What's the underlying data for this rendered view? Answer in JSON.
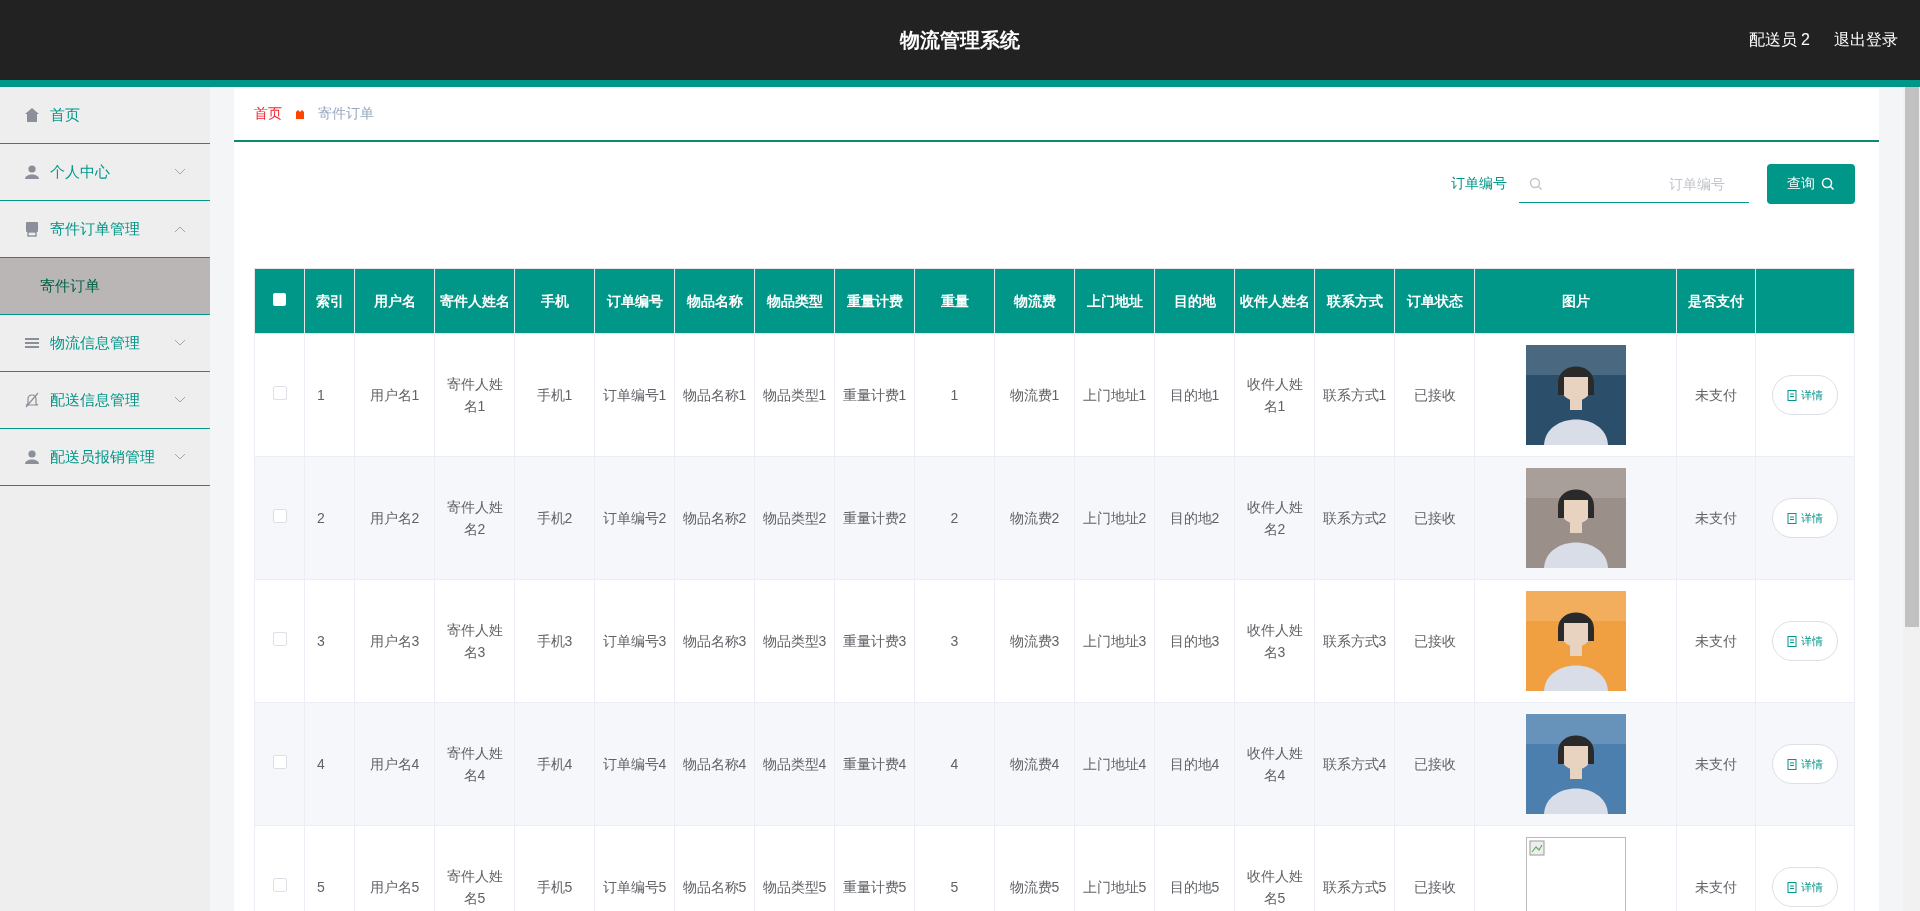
{
  "header": {
    "title": "物流管理系统",
    "user": "配送员 2",
    "logout": "退出登录"
  },
  "sidebar": {
    "items": [
      {
        "kind": "link",
        "label": "首页"
      },
      {
        "kind": "group",
        "label": "个人中心",
        "expanded": false
      },
      {
        "kind": "group",
        "label": "寄件订单管理",
        "expanded": true,
        "children": [
          {
            "label": "寄件订单",
            "selected": true
          }
        ]
      },
      {
        "kind": "group",
        "label": "物流信息管理",
        "expanded": false
      },
      {
        "kind": "group",
        "label": "配送信息管理",
        "expanded": false
      },
      {
        "kind": "group",
        "label": "配送员报销管理",
        "expanded": false
      }
    ]
  },
  "breadcrumb": {
    "home": "首页",
    "current": "寄件订单"
  },
  "search": {
    "label": "订单编号",
    "placeholder": "订单编号",
    "button": "查询"
  },
  "table": {
    "all_checked": false,
    "columns": [
      "索引",
      "用户名",
      "寄件人姓名",
      "手机",
      "订单编号",
      "物品名称",
      "物品类型",
      "重量计费",
      "重量",
      "物流费",
      "上门地址",
      "目的地",
      "收件人姓名",
      "联系方式",
      "订单状态",
      "图片",
      "是否支付"
    ],
    "rows": [
      {
        "selected": false,
        "cells": [
          "1",
          "用户名1",
          "寄件人姓名1",
          "手机1",
          "订单编号1",
          "物品名称1",
          "物品类型1",
          "重量计费1",
          "1",
          "物流费1",
          "上门地址1",
          "目的地1",
          "收件人姓名1",
          "联系方式1",
          "已接收"
        ],
        "paid": "未支付",
        "action": "详情"
      },
      {
        "selected": false,
        "cells": [
          "2",
          "用户名2",
          "寄件人姓名2",
          "手机2",
          "订单编号2",
          "物品名称2",
          "物品类型2",
          "重量计费2",
          "2",
          "物流费2",
          "上门地址2",
          "目的地2",
          "收件人姓名2",
          "联系方式2",
          "已接收"
        ],
        "paid": "未支付",
        "action": "详情"
      },
      {
        "selected": false,
        "cells": [
          "3",
          "用户名3",
          "寄件人姓名3",
          "手机3",
          "订单编号3",
          "物品名称3",
          "物品类型3",
          "重量计费3",
          "3",
          "物流费3",
          "上门地址3",
          "目的地3",
          "收件人姓名3",
          "联系方式3",
          "已接收"
        ],
        "paid": "未支付",
        "action": "详情"
      },
      {
        "selected": false,
        "cells": [
          "4",
          "用户名4",
          "寄件人姓名4",
          "手机4",
          "订单编号4",
          "物品名称4",
          "物品类型4",
          "重量计费4",
          "4",
          "物流费4",
          "上门地址4",
          "目的地4",
          "收件人姓名4",
          "联系方式4",
          "已接收"
        ],
        "paid": "未支付",
        "action": "详情"
      },
      {
        "selected": false,
        "cells": [
          "5",
          "用户名5",
          "寄件人姓名5",
          "手机5",
          "订单编号5",
          "物品名称5",
          "物品类型5",
          "重量计费5",
          "5",
          "物流费5",
          "上门地址5",
          "目的地5",
          "收件人姓名5",
          "联系方式5",
          "已接收"
        ],
        "picture": {
          "kind": "broken"
        },
        "paid": "未支付",
        "action": "详情"
      }
    ]
  }
}
